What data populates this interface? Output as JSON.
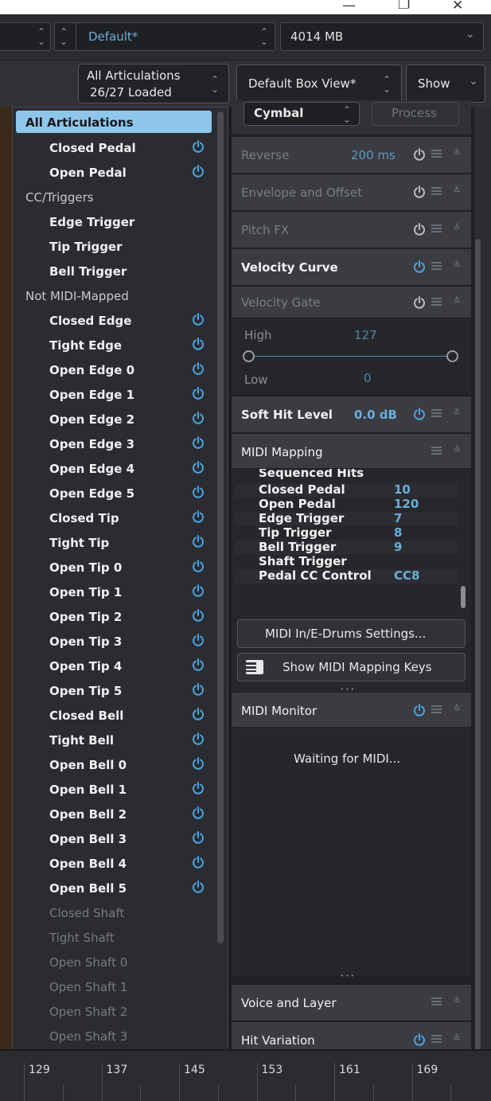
{
  "window": {
    "minimize_glyph": "—",
    "restore_glyph": "❐",
    "close_glyph": "✕"
  },
  "toolbar": {
    "preset": "Default*",
    "memory": "4014 MB",
    "articulation_filter_title": "All Articulations",
    "articulation_filter_count": "26/27 Loaded",
    "box_view": "Default Box View*",
    "show_label": "Show"
  },
  "articulations": [
    {
      "label": "All Articulations",
      "type": "selected",
      "power": false
    },
    {
      "label": "Closed Pedal",
      "type": "item",
      "power": true
    },
    {
      "label": "Open Pedal",
      "type": "item",
      "power": true
    },
    {
      "label": "CC/Triggers",
      "type": "head",
      "power": false
    },
    {
      "label": "Edge Trigger",
      "type": "item",
      "power": false
    },
    {
      "label": "Tip Trigger",
      "type": "item",
      "power": false
    },
    {
      "label": "Bell Trigger",
      "type": "item",
      "power": false
    },
    {
      "label": "Not MIDI-Mapped",
      "type": "head",
      "power": false
    },
    {
      "label": "Closed Edge",
      "type": "item",
      "power": true
    },
    {
      "label": "Tight Edge",
      "type": "item",
      "power": true
    },
    {
      "label": "Open Edge 0",
      "type": "item",
      "power": true
    },
    {
      "label": "Open Edge 1",
      "type": "item",
      "power": true
    },
    {
      "label": "Open Edge 2",
      "type": "item",
      "power": true
    },
    {
      "label": "Open Edge 3",
      "type": "item",
      "power": true
    },
    {
      "label": "Open Edge 4",
      "type": "item",
      "power": true
    },
    {
      "label": "Open Edge 5",
      "type": "item",
      "power": true
    },
    {
      "label": "Closed Tip",
      "type": "item",
      "power": true
    },
    {
      "label": "Tight Tip",
      "type": "item",
      "power": true
    },
    {
      "label": "Open Tip 0",
      "type": "item",
      "power": true
    },
    {
      "label": "Open Tip 1",
      "type": "item",
      "power": true
    },
    {
      "label": "Open Tip 2",
      "type": "item",
      "power": true
    },
    {
      "label": "Open Tip 3",
      "type": "item",
      "power": true
    },
    {
      "label": "Open Tip 4",
      "type": "item",
      "power": true
    },
    {
      "label": "Open Tip 5",
      "type": "item",
      "power": true
    },
    {
      "label": "Closed Bell",
      "type": "item",
      "power": true
    },
    {
      "label": "Tight Bell",
      "type": "item",
      "power": true
    },
    {
      "label": "Open Bell 0",
      "type": "item",
      "power": true
    },
    {
      "label": "Open Bell 1",
      "type": "item",
      "power": true
    },
    {
      "label": "Open Bell 2",
      "type": "item",
      "power": true
    },
    {
      "label": "Open Bell 3",
      "type": "item",
      "power": true
    },
    {
      "label": "Open Bell 4",
      "type": "item",
      "power": true
    },
    {
      "label": "Open Bell 5",
      "type": "item",
      "power": true
    },
    {
      "label": "Closed Shaft",
      "type": "dim",
      "power": false
    },
    {
      "label": "Tight Shaft",
      "type": "dim",
      "power": false
    },
    {
      "label": "Open Shaft 0",
      "type": "dim",
      "power": false
    },
    {
      "label": "Open Shaft 1",
      "type": "dim",
      "power": false
    },
    {
      "label": "Open Shaft 2",
      "type": "dim",
      "power": false
    },
    {
      "label": "Open Shaft 3",
      "type": "dim",
      "power": false
    }
  ],
  "panel": {
    "instrument_select": "Cymbal",
    "process_button": "Process",
    "reverse": {
      "title": "Reverse",
      "value": "200 ms"
    },
    "envelope": {
      "title": "Envelope and Offset"
    },
    "pitchfx": {
      "title": "Pitch FX"
    },
    "velocity_curve": {
      "title": "Velocity Curve"
    },
    "velocity_gate": {
      "title": "Velocity Gate",
      "high_label": "High",
      "high_value": "127",
      "low_label": "Low",
      "low_value": "0"
    },
    "soft_hit": {
      "title": "Soft Hit Level",
      "value": "0.0 dB"
    },
    "midi_mapping": {
      "title": "MIDI Mapping",
      "partial_row": "Sequenced Hits",
      "rows": [
        {
          "key": "Closed Pedal",
          "value": "10"
        },
        {
          "key": "Open Pedal",
          "value": "120"
        },
        {
          "key": "Edge Trigger",
          "value": "7"
        },
        {
          "key": "Tip Trigger",
          "value": "8"
        },
        {
          "key": "Bell Trigger",
          "value": "9"
        },
        {
          "key": "Shaft Trigger",
          "value": ""
        },
        {
          "key": "Pedal CC Control",
          "value": "CC8"
        }
      ],
      "settings_button": "MIDI In/E-Drums Settings...",
      "keys_button": "Show MIDI Mapping Keys",
      "resize_grip": "• • •"
    },
    "midi_monitor": {
      "title": "MIDI Monitor",
      "status": "Waiting for MIDI...",
      "resize_grip": "• • •"
    },
    "voice_layer": {
      "title": "Voice and Layer"
    },
    "hit_variation": {
      "title": "Hit Variation"
    }
  },
  "colors": {
    "accent": "#6aaed9",
    "power_on": "#4ba3e0",
    "power_off": "#b9bbc0",
    "selected_bg": "#8fc7ea"
  },
  "ruler": {
    "labels": [
      "129",
      "137",
      "145",
      "153",
      "161",
      "169"
    ]
  }
}
